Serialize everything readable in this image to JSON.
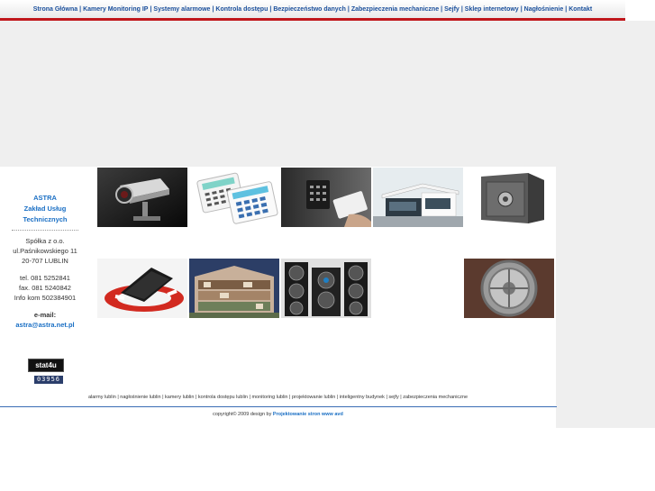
{
  "nav": {
    "items": [
      "Strona Główna",
      "Kamery Monitoring IP",
      "Systemy alarmowe",
      "Kontrola dostępu",
      "Bezpieczeństwo danych",
      "Zabezpieczenia mechaniczne",
      "Sejfy",
      "Sklep internetowy",
      "Nagłośnienie",
      "Kontakt"
    ],
    "separator": "|"
  },
  "sidebar": {
    "name1": "ASTRA",
    "name2": "Zakład Usług",
    "name3": "Technicznych",
    "company": "Spółka z o.o.",
    "street": "ul.Paśnikowskiego 11",
    "city": "20-707 LUBLIN",
    "tel": "tel. 081 5252841",
    "fax": "fax. 081 5240842",
    "info": "Info kom 502384901",
    "email_label": "e-mail:",
    "email": "astra@astra.net.pl"
  },
  "counter": {
    "logo": "stat4u",
    "digits": "03956"
  },
  "tiles": [
    {
      "name": "cctv-camera-image"
    },
    {
      "name": "alarm-keypad-image"
    },
    {
      "name": "access-control-image"
    },
    {
      "name": "smart-building-image"
    },
    {
      "name": "safe-image"
    },
    {
      "name": "data-security-laptop-image"
    },
    {
      "name": "building-design-image"
    },
    {
      "name": "speakers-image"
    },
    {
      "name": "vault-door-image"
    }
  ],
  "footer": {
    "links": "alarmy lublin | nagłośnienie lublin | kamery lublin | kontrola dostępu lublin | monitoring lublin | projektowanie lublin | inteligentny budynek | sejfy | zabezpieczenia mechaniczne",
    "copyright_text": "copyright© 2009 design by",
    "copyright_link": "Projektowanie stron www avd"
  },
  "colors": {
    "accent_red": "#c0161b",
    "link_blue": "#1a6fc4",
    "nav_blue": "#1a4f9c"
  }
}
